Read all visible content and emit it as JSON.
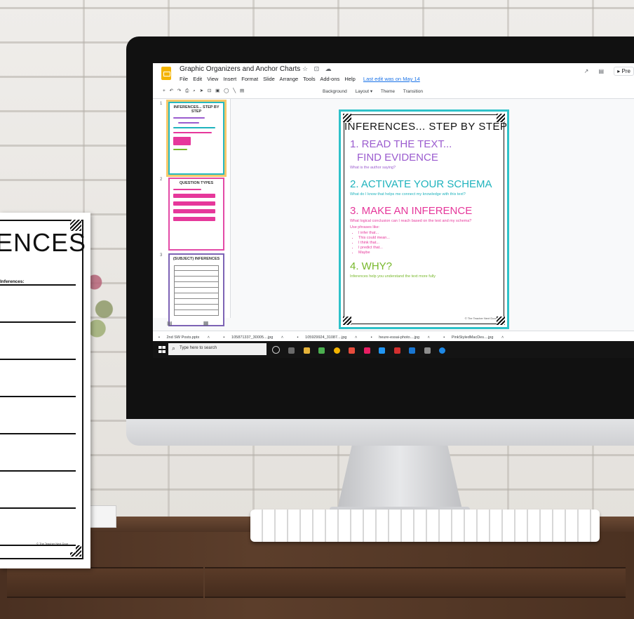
{
  "app": {
    "doc_title": "Graphic Organizers and Anchor Charts",
    "title_icons": "☆ ⊡ ☁",
    "menu": [
      "File",
      "Edit",
      "View",
      "Insert",
      "Format",
      "Slide",
      "Arrange",
      "Tools",
      "Add-ons",
      "Help"
    ],
    "last_edit": "Last edit was on May 14",
    "present_label": "Pre",
    "toolbar_buttons": [
      "Background",
      "Layout ▾",
      "Theme",
      "Transition"
    ]
  },
  "filmstrip": {
    "slides": [
      {
        "number": "1",
        "title": "INFERENCES... STEP BY STEP"
      },
      {
        "number": "2",
        "title": "QUESTION TYPES"
      },
      {
        "number": "3",
        "title": "(SUBJECT) INFERENCES"
      }
    ]
  },
  "slide": {
    "title": "INFERENCES... STEP BY STEP",
    "step1": "1. READ THE TEXT...",
    "step1_sub": "FIND EVIDENCE",
    "step1_prompt": "What is the author saying?",
    "step2": "2. ACTIVATE YOUR SCHEMA",
    "step2_prompt": "What do I know that helps me connect my knowledge with this text?",
    "step3": "3. MAKE AN INFERENCE",
    "step3_prompt": "What logical conclusion can I reach based on the text and my schema?",
    "phrases_label": "Use phrases like:",
    "phrases": [
      "I infer that...",
      "This could mean...",
      "I think that...",
      "I predict that...",
      "Maybe"
    ],
    "step4": "4. WHY?",
    "step4_prompt": "Inferences help you understand the text more fully",
    "credit": "© The Teacher Next Door"
  },
  "downloads": [
    "2nd SW Posts.pptx",
    "105871337_30005....jpg",
    "105929924_31087....jpg",
    "heure-essai-photo....jpg",
    "PinkStyledMacDes....jpg"
  ],
  "taskbar": {
    "search_placeholder": "Type here to search"
  },
  "paper": {
    "title": "ENCES",
    "label": "Inferences:",
    "credit": "© The Teacher Next Door"
  },
  "colors": {
    "teal": "#2fc2c9",
    "purple": "#9b5ccf",
    "pink": "#e6389b",
    "green": "#77b82a",
    "slides_yellow": "#f4b400"
  }
}
